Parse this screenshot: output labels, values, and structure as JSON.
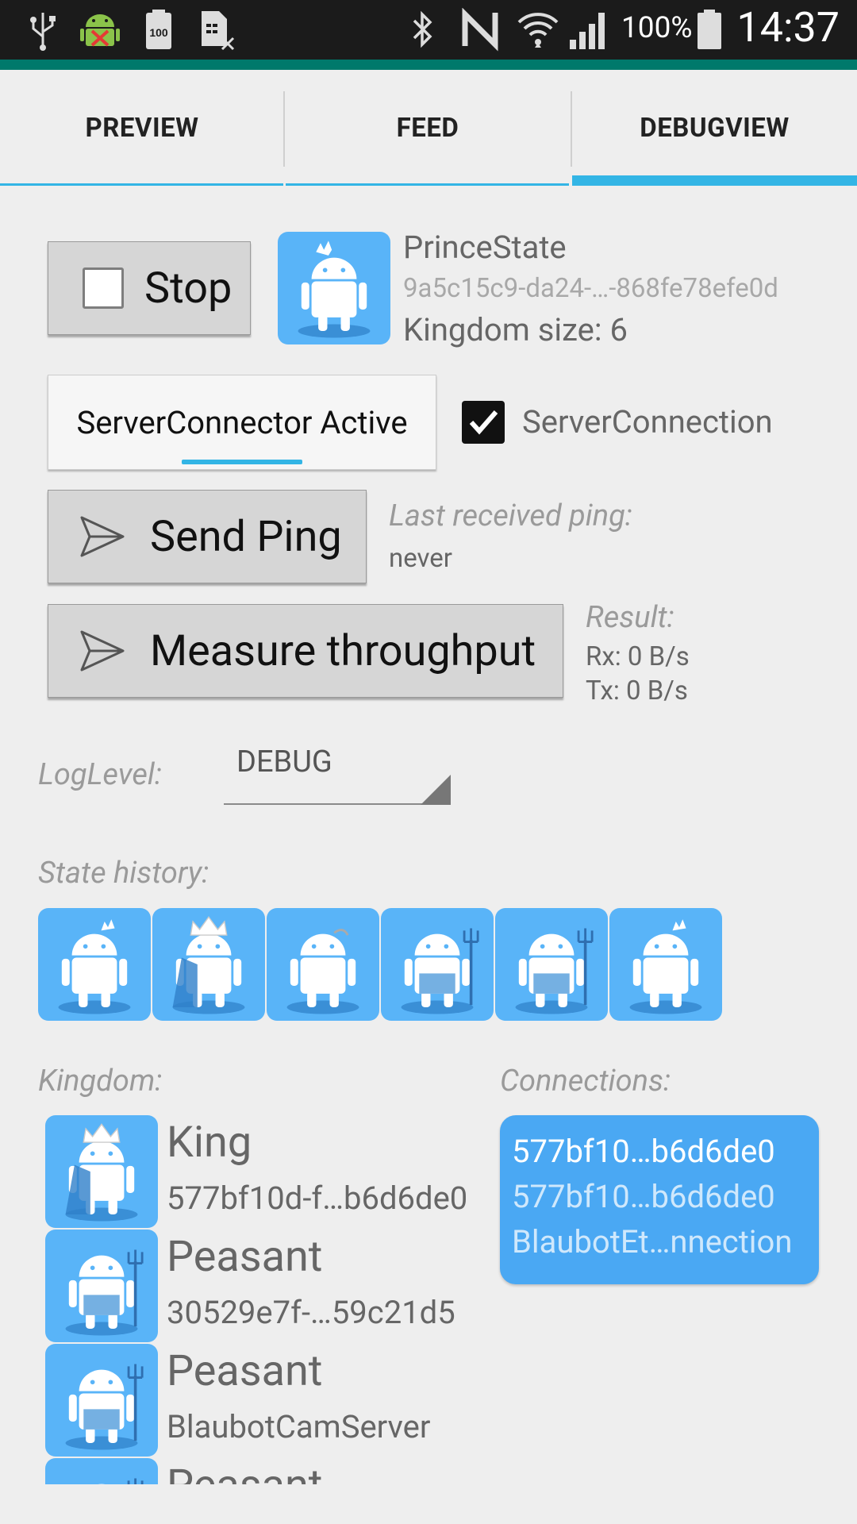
{
  "statusbar": {
    "icons": [
      "usb-icon",
      "android-debug-icon",
      "battery-100-icon",
      "sim-card-x-icon",
      "bluetooth-icon",
      "nfc-icon",
      "wifi-icon",
      "signal-icon",
      "battery-icon"
    ],
    "battery_percent": "100%",
    "time": "14:37"
  },
  "tabs": [
    {
      "label": "PREVIEW",
      "selected": false
    },
    {
      "label": "FEED",
      "selected": false
    },
    {
      "label": "DEBUGVIEW",
      "selected": true
    }
  ],
  "state": {
    "stop_label": "Stop",
    "stop_checked": false,
    "title": "PrinceState",
    "uuid": "9a5c15c9-da24-…-868fe78efe0d",
    "kingdom_size": "Kingdom size: 6"
  },
  "server": {
    "toggle_label": "ServerConnector Active",
    "connection_label": "ServerConnection",
    "connection_checked": true
  },
  "ping": {
    "button_label": "Send Ping",
    "last_label": "Last received ping:",
    "last_value": "never"
  },
  "throughput": {
    "button_label": "Measure throughput",
    "result_label": "Result:",
    "rx": "Rx: 0 B/s",
    "tx": "Tx: 0 B/s"
  },
  "loglevel": {
    "label": "LogLevel:",
    "value": "DEBUG"
  },
  "history": {
    "label": "State history:",
    "states": [
      "prince",
      "king",
      "free",
      "peasant",
      "peasant-fork",
      "prince"
    ]
  },
  "kingdom": {
    "label": "Kingdom:",
    "members": [
      {
        "role": "King",
        "id": "577bf10d-f…b6d6de0",
        "icon": "king"
      },
      {
        "role": "Peasant",
        "id": "30529e7f-…59c21d5",
        "icon": "peasant"
      },
      {
        "role": "Peasant",
        "id": "BlaubotCamServer",
        "icon": "peasant"
      },
      {
        "role": "Peasant",
        "id": "",
        "icon": "peasant"
      }
    ]
  },
  "connections": {
    "label": "Connections:",
    "items": [
      {
        "line1": "577bf10…b6d6de0",
        "line2": "577bf10…b6d6de0",
        "line3": "BlaubotEt…nnection"
      }
    ]
  },
  "colors": {
    "accent": "#33b5e5",
    "avatar_bg": "#59b4f8",
    "statusbar": "#1b1b1b",
    "teal": "#00796b"
  }
}
